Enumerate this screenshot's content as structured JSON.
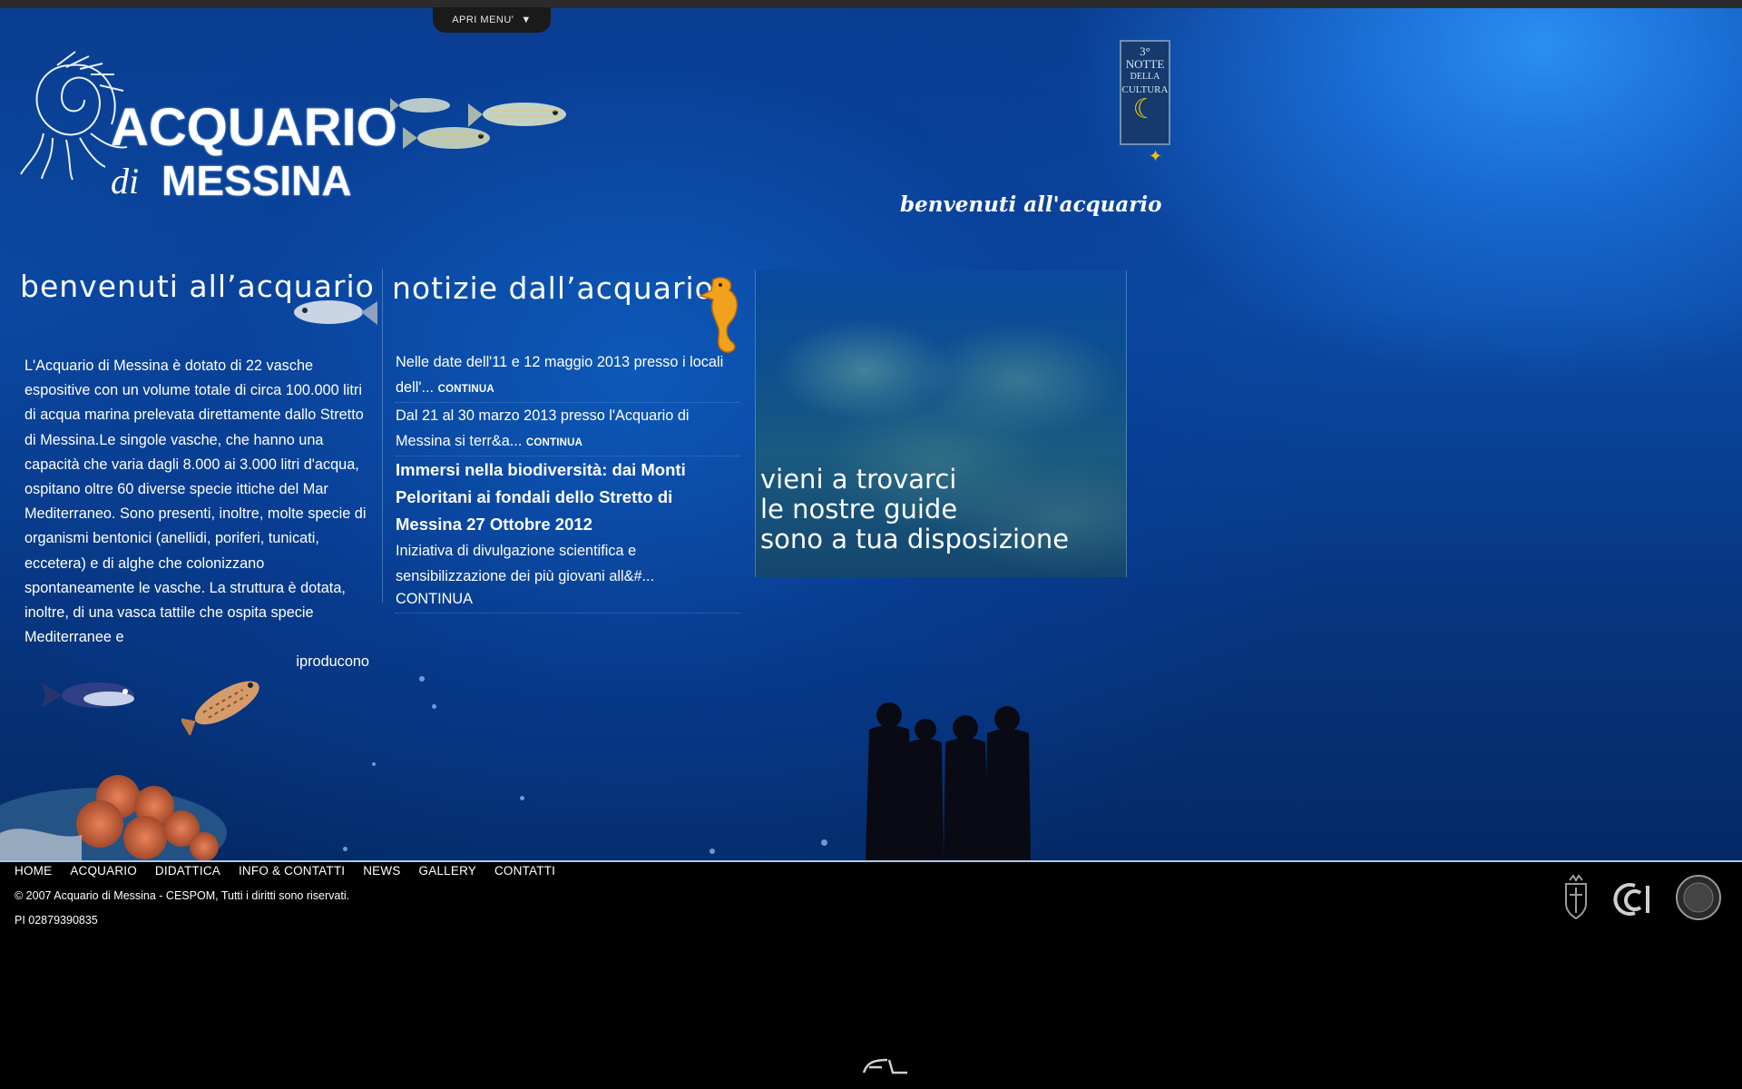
{
  "menu": {
    "label": "APRI MENU'"
  },
  "logo": {
    "line1": "ACQUARIO",
    "di": "di",
    "line2": "MESSINA"
  },
  "badge": {
    "number": "3°",
    "line1": "NOTTE",
    "line2": "DELLA",
    "line3": "CULTURA"
  },
  "header": {
    "welcome": "benvenuti all'acquario"
  },
  "welcome_col": {
    "title": "benvenuti all’acquario",
    "text": "L'Acquario di Messina è dotato di 22 vasche espositive con un volume totale di circa 100.000 litri di acqua marina prelevata direttamente dallo Stretto di Messina.Le singole vasche, che hanno una capacità che varia dagli 8.000 ai 3.000 litri d'acqua, ospitano oltre 60 diverse specie ittiche del Mar Mediterraneo. Sono presenti, inoltre, molte specie di organismi bentonici (anellidi, poriferi, tunicati, eccetera) e di alghe che colonizzano spontaneamente le vasche. La struttura è dotata, inoltre, di una vasca tattile che ospita specie Mediterranee e",
    "more": "iproducono"
  },
  "news_col": {
    "title": "notizie dall’acquario",
    "items": [
      {
        "text": "Nelle date dell'11 e 12 maggio 2013 presso i locali dell'...",
        "more": "CONTINUA"
      },
      {
        "text": "Dal 21 al 30 marzo 2013 presso l'Acquario di Messina si terr&a...",
        "more": "CONTINUA"
      },
      {
        "title": "Immersi nella biodiversità: dai Monti Peloritani ai fondali dello Stretto di Messina 27 Ottobre 2012",
        "text": "Iniziativa di divulgazione scientifica e sensibilizzazione dei più giovani all&#...",
        "more": "CONTINUA"
      }
    ]
  },
  "promo": {
    "line1": "vieni a trovarci",
    "line2": "le nostre guide",
    "line3": "sono a tua disposizione"
  },
  "footer": {
    "nav": [
      "HOME",
      "ACQUARIO",
      "DIDATTICA",
      "INFO & CONTATTI",
      "NEWS",
      "GALLERY",
      "CONTATTI"
    ],
    "copyright": "© 2007 Acquario di Messina - CESPOM, Tutti i diritti sono riservati.",
    "vat": "PI 02879390835"
  },
  "colors": {
    "ocean_light": "#2a8ff0",
    "ocean_dark": "#042a66",
    "footer_bg": "#000000",
    "accent_yellow": "#f2c200"
  }
}
